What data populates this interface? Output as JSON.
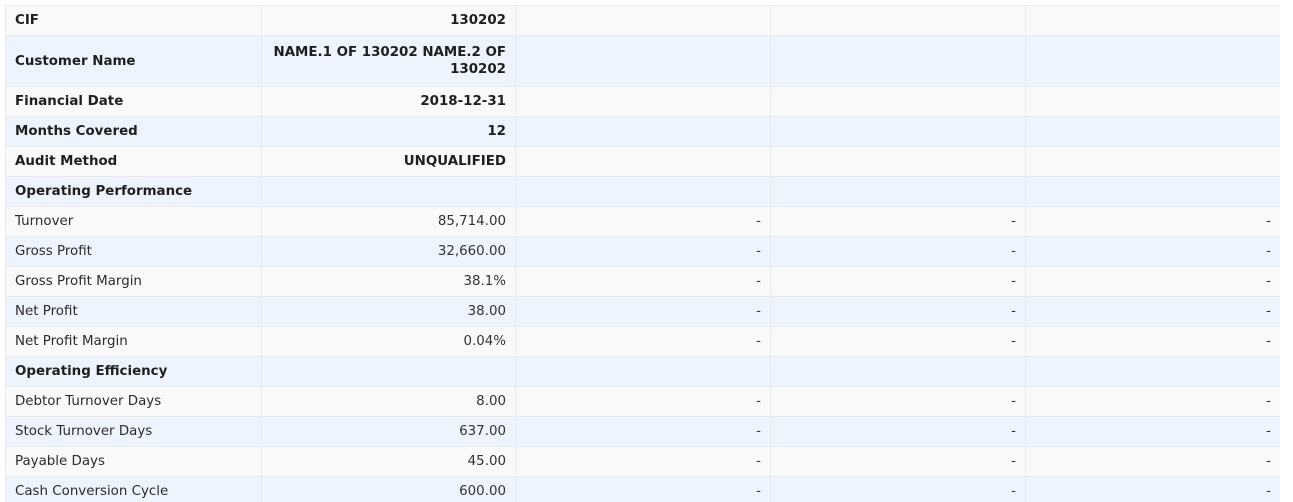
{
  "header_rows": [
    {
      "label": "CIF",
      "value": "130202"
    },
    {
      "label": "Customer Name",
      "value": "NAME.1 OF 130202 NAME.2 OF 130202"
    },
    {
      "label": "Financial Date",
      "value": "2018-12-31"
    },
    {
      "label": "Months Covered",
      "value": "12"
    },
    {
      "label": "Audit Method",
      "value": "UNQUALIFIED"
    }
  ],
  "sections": {
    "operating_performance": "Operating Performance",
    "operating_efficiency": "Operating Efficiency"
  },
  "operating_performance_rows": [
    {
      "label": "Turnover",
      "value": "85,714.00",
      "col2": "-",
      "col3": "-",
      "col4": "-"
    },
    {
      "label": "Gross Profit",
      "value": "32,660.00",
      "col2": "-",
      "col3": "-",
      "col4": "-"
    },
    {
      "label": "Gross Profit Margin",
      "value": "38.1%",
      "col2": "-",
      "col3": "-",
      "col4": "-"
    },
    {
      "label": "Net Profit",
      "value": "38.00",
      "col2": "-",
      "col3": "-",
      "col4": "-"
    },
    {
      "label": "Net Profit Margin",
      "value": "0.04%",
      "col2": "-",
      "col3": "-",
      "col4": "-"
    }
  ],
  "operating_efficiency_rows": [
    {
      "label": "Debtor Turnover Days",
      "value": "8.00",
      "col2": "-",
      "col3": "-",
      "col4": "-"
    },
    {
      "label": "Stock Turnover Days",
      "value": "637.00",
      "col2": "-",
      "col3": "-",
      "col4": "-"
    },
    {
      "label": "Payable Days",
      "value": "45.00",
      "col2": "-",
      "col3": "-",
      "col4": "-"
    },
    {
      "label": "Cash Conversion Cycle",
      "value": "600.00",
      "col2": "-",
      "col3": "-",
      "col4": "-"
    }
  ]
}
